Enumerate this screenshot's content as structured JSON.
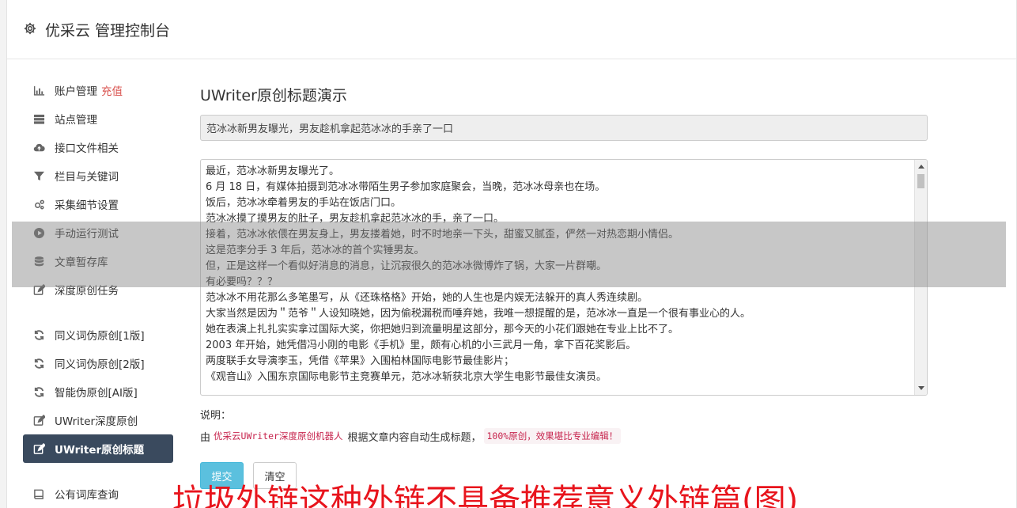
{
  "header": {
    "title": "优采云 管理控制台",
    "icon": "gear-icon"
  },
  "sidebar": {
    "items": [
      {
        "label": "账户管理",
        "badge": "充值",
        "icon": "bar-chart-icon"
      },
      {
        "label": "站点管理",
        "icon": "server-icon"
      },
      {
        "label": "接口文件相关",
        "icon": "cloud-upload-icon"
      },
      {
        "label": "栏目与关键词",
        "icon": "filter-icon"
      },
      {
        "label": "采集细节设置",
        "icon": "gears-icon"
      },
      {
        "label": "手动运行测试",
        "icon": "play-circle-icon"
      },
      {
        "label": "文章暂存库",
        "icon": "database-icon"
      },
      {
        "label": "深度原创任务",
        "icon": "edit-icon"
      },
      {
        "label": "同义词伪原创[1版]",
        "icon": "refresh-icon"
      },
      {
        "label": "同义词伪原创[2版]",
        "icon": "refresh-icon"
      },
      {
        "label": "智能伪原创[AI版]",
        "icon": "refresh-icon"
      },
      {
        "label": "UWriter深度原创",
        "icon": "edit-icon"
      },
      {
        "label": "UWriter原创标题",
        "icon": "edit-icon",
        "active": true
      },
      {
        "label": "公有词库查询",
        "icon": "book-icon"
      }
    ]
  },
  "main": {
    "title": "UWriter原创标题演示",
    "title_value": "范冰冰新男友曝光，男友趁机拿起范冰冰的手亲了一口",
    "content_lines": [
      "最近，范冰冰新男友曝光了。",
      "6 月 18 日，有媒体拍摄到范冰冰带陌生男子参加家庭聚会，当晚，范冰冰母亲也在场。",
      "饭后，范冰冰牵着男友的手站在饭店门口。",
      "范冰冰摸了摸男友的肚子，男友趁机拿起范冰冰的手，亲了一口。",
      "接着，范冰冰依偎在男友身上，男友搂着她，时不时地亲一下头，甜蜜又腻歪，俨然一对热恋期小情侣。",
      "这是范李分手 3 年后，范冰冰的首个实锤男友。",
      "但，正是这样一个看似好消息的消息，让沉寂很久的范冰冰微博炸了锅，大家一片群嘲。",
      "有必要吗？？？",
      "范冰冰不用花那么多笔墨写，从《还珠格格》开始，她的人生也是内娱无法躲开的真人秀连续剧。",
      "大家当然是因为＂范爷＂人设知晓她，因为偷税漏税而唾弃她，我唯一想提醒的是，范冰冰一直是一个很有事业心的人。",
      "她在表演上扎扎实实拿过国际大奖，你把她归到流量明星这部分，那今天的小花们跟她在专业上比不了。",
      "2003 年开始，她凭借冯小刚的电影《手机》里，颇有心机的小三武月一角，拿下百花奖影后。",
      "两度联手女导演李玉，凭借《苹果》入围柏林国际电影节最佳影片；",
      "《观音山》入围东京国际电影节主竞赛单元，范冰冰斩获北京大学生电影节最佳女演员。"
    ],
    "note_label": "说明：",
    "note_prefix": "由",
    "note_code1": "优采云UWriter深度原创机器人",
    "note_middle": "根据文章内容自动生成标题，",
    "note_code2": "100%原创，效果堪比专业编辑！",
    "submit_label": "提交",
    "clear_label": "清空"
  },
  "watermark": "垃圾外链这种外链不具备推荐意义外链篇(图)",
  "colors": {
    "active_bg": "#3a4a5e",
    "submit": "#5bc0de",
    "badge": "#d9534f",
    "watermark": "#e8141c"
  }
}
